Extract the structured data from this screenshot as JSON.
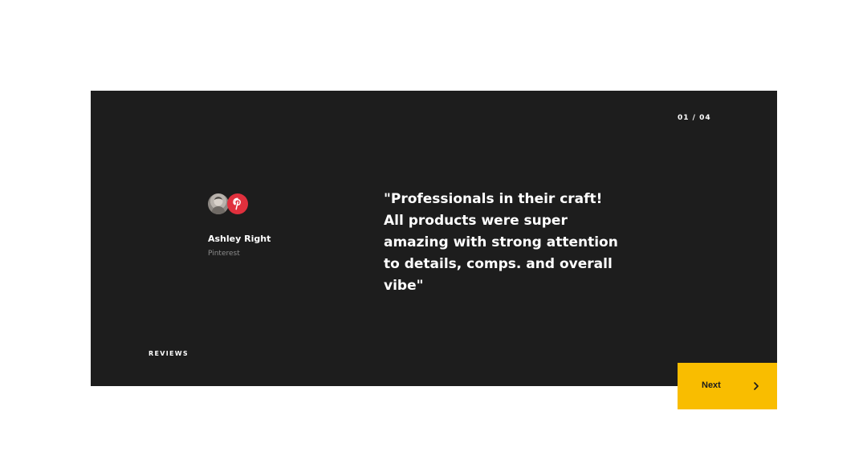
{
  "section": {
    "label": "REVIEWS"
  },
  "slider": {
    "counter": "01 / 04"
  },
  "testimonial": {
    "quote": "\"Professionals in their craft! All products were super amazing with strong attention to details, comps. and overall vibe\"",
    "author_name": "Ashley Right",
    "author_company": "Pinterest"
  },
  "navigation": {
    "next_label": "Next"
  },
  "colors": {
    "panel_background": "#1d1d1d",
    "accent": "#f9bd00",
    "pinterest_red": "#e0303d"
  },
  "icons": {
    "avatar": "author-avatar",
    "badge": "pinterest-icon",
    "next": "chevron-right-icon"
  }
}
